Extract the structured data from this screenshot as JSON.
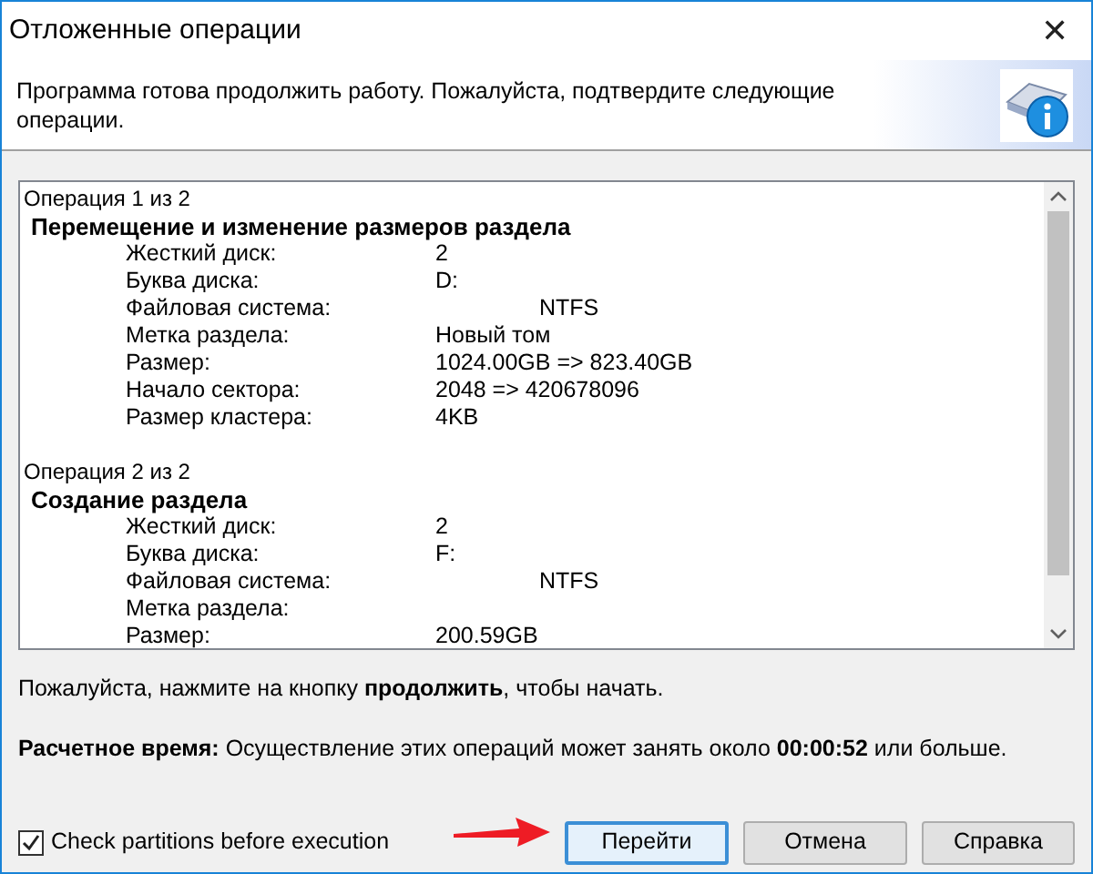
{
  "window": {
    "title": "Отложенные операции",
    "close": "✕"
  },
  "header": {
    "message": "Программа готова продолжить работу. Пожалуйста, подтвердите следующие операции."
  },
  "operations": [
    {
      "counter": "Операция 1 из 2",
      "title": "Перемещение и изменение размеров раздела",
      "fields": [
        {
          "label": "Жесткий диск:",
          "value": "2",
          "kind": "plain"
        },
        {
          "label": "Буква диска:",
          "value": "D:",
          "kind": "plain"
        },
        {
          "label": "Файловая система:",
          "value": "NTFS",
          "kind": "indented"
        },
        {
          "label": "Метка раздела:",
          "value": "Новый том",
          "kind": "plain"
        },
        {
          "label": "Размер:",
          "value": "1024.00GB => 823.40GB",
          "kind": "plain"
        },
        {
          "label": "Начало сектора:",
          "value": "2048 => 420678096",
          "kind": "plain"
        },
        {
          "label": "Размер кластера:",
          "value": "4KB",
          "kind": "plain"
        }
      ]
    },
    {
      "counter": "Операция 2 из 2",
      "title": "Создание раздела",
      "fields": [
        {
          "label": "Жесткий диск:",
          "value": "2",
          "kind": "plain"
        },
        {
          "label": "Буква диска:",
          "value": "F:",
          "kind": "plain"
        },
        {
          "label": "Файловая система:",
          "value": "NTFS",
          "kind": "indented"
        },
        {
          "label": "Метка раздела:"
        },
        {
          "label": "Размер:",
          "value": "200.59GB",
          "kind": "plain"
        }
      ]
    }
  ],
  "instruction": "Пожалуйста, нажмите на кнопку **продолжить**, чтобы начать.",
  "estimate": "**Расчетное время:** Осуществление этих операций может занять около **00:00:52** или больше.",
  "check_partitions": {
    "label": "Check partitions before execution",
    "checked": true
  },
  "buttons": [
    {
      "label": "Перейти",
      "default": true
    },
    {
      "label": "Отмена",
      "default": false
    },
    {
      "label": "Справка",
      "default": false
    }
  ]
}
